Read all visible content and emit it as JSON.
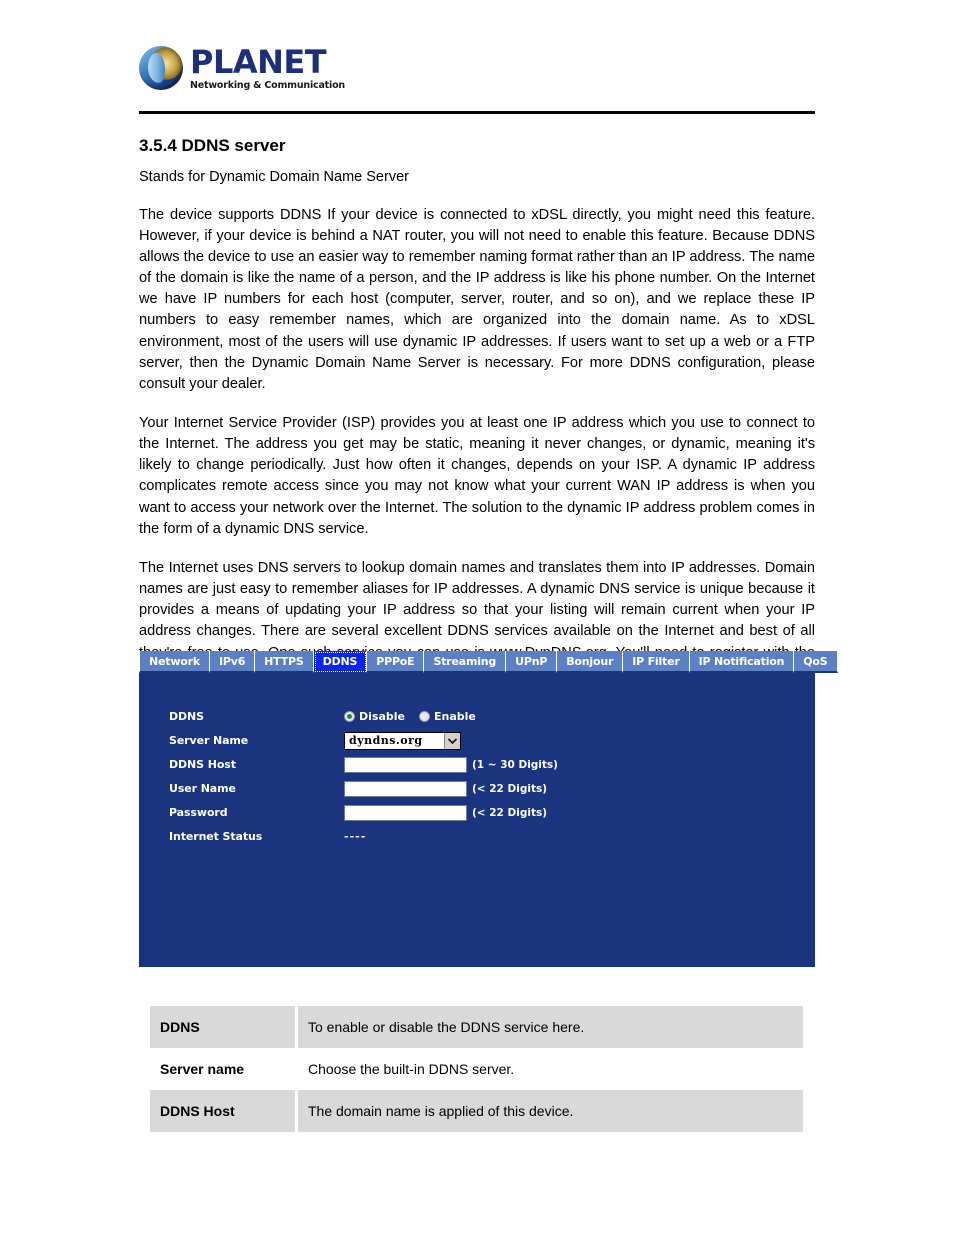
{
  "header": {
    "logo_name": "PLANET",
    "logo_tagline": "Networking & Communication"
  },
  "document": {
    "section_number_title": "3.5.4 DDNS server",
    "lead": "Stands for Dynamic Domain Name Server",
    "paragraphs": [
      "The device supports DDNS If your device is connected to xDSL directly, you might need this feature. However, if your device is behind a NAT router, you will not need to enable this feature. Because DDNS allows the device to use an easier way to remember naming format rather than an IP address. The name of the domain is like the name of a person, and the IP address is like his phone number. On the Internet we have IP numbers for each host (computer, server, router, and so on), and we replace these IP numbers to easy remember names, which are organized into the domain name. As to xDSL environment, most of the users will use dynamic IP addresses. If users want to set up a web or a FTP server, then the Dynamic Domain Name Server is necessary. For more DDNS configuration, please consult your dealer.",
      "Your Internet Service Provider (ISP) provides you at least one IP address which you use to connect to the Internet. The address you get may be static, meaning it never changes, or dynamic, meaning it's likely to change periodically. Just how often it changes, depends on your ISP. A dynamic IP address complicates remote access since you may not know what your current WAN IP address is when you want to access your network over the Internet. The solution to the dynamic IP address problem comes in the form of a dynamic DNS service.",
      "The Internet uses DNS servers to lookup domain names and translates them into IP addresses. Domain names are just easy to remember aliases for IP addresses.   A dynamic DNS service is unique because it provides a means of updating your IP address so that your listing will remain current when your IP address changes. There are several excellent DDNS services available on the Internet and best of all they're free to use. One such service you can use is www.DynDNS.org. You'll need to register with the service and set up the domain name of your choice to begin using it. Please refer to the home page of the service for detailed instructions or refer to Appendix E for more information."
    ]
  },
  "device_ui": {
    "tabs": [
      {
        "label": "Network",
        "active": false
      },
      {
        "label": "IPv6",
        "active": false
      },
      {
        "label": "HTTPS",
        "active": false
      },
      {
        "label": "DDNS",
        "active": true
      },
      {
        "label": "PPPoE",
        "active": false
      },
      {
        "label": "Streaming",
        "active": false
      },
      {
        "label": "UPnP",
        "active": false
      },
      {
        "label": "Bonjour",
        "active": false
      },
      {
        "label": "IP Filter",
        "active": false
      },
      {
        "label": "IP Notification",
        "active": false
      },
      {
        "label": "QoS",
        "active": false
      }
    ],
    "fields": {
      "ddns_label": "DDNS",
      "ddns_option_disable": "Disable",
      "ddns_option_enable": "Enable",
      "ddns_selected": "Disable",
      "server_name_label": "Server Name",
      "server_name_value": "dyndns.org",
      "ddns_host_label": "DDNS Host",
      "ddns_host_value": "",
      "ddns_host_hint": "(1 ~ 30 Digits)",
      "user_name_label": "User Name",
      "user_name_value": "",
      "user_name_hint": "(< 22 Digits)",
      "password_label": "Password",
      "password_value": "",
      "password_hint": "(< 22 Digits)",
      "internet_status_label": "Internet Status",
      "internet_status_value": "----"
    },
    "colors": {
      "panel_bg": "#1b3480",
      "tab_bg": "#5b81c4",
      "tab_active_bg": "#0a24e8",
      "radio_selected": "#1f8f3a"
    }
  },
  "description_table": {
    "rows": [
      {
        "term": "DDNS",
        "definition": "To enable or disable the DDNS service here.",
        "shaded": true
      },
      {
        "term": "Server name",
        "definition": "Choose the built-in DDNS server.",
        "shaded": false
      },
      {
        "term": "DDNS Host",
        "definition": "The domain name is applied of this device.",
        "shaded": true
      }
    ]
  }
}
